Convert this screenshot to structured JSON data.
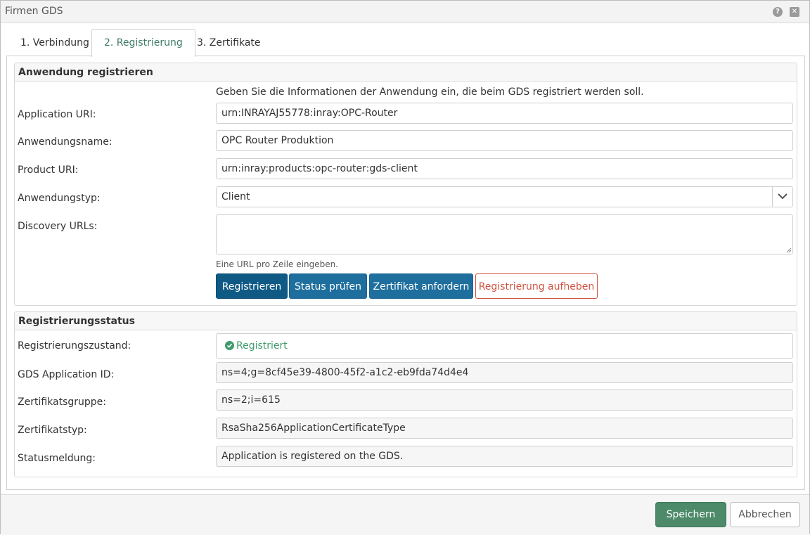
{
  "window": {
    "title": "Firmen GDS",
    "help_glyph": "?",
    "close_glyph": "✕"
  },
  "tabs": [
    {
      "label": "1. Verbindung"
    },
    {
      "label": "2. Registrierung",
      "active": true
    },
    {
      "label": "3. Zertifikate"
    }
  ],
  "registration": {
    "legend": "Anwendung registrieren",
    "intro": "Geben Sie die Informationen der Anwendung ein, die beim GDS registriert werden soll.",
    "application_uri": {
      "label": "Application URI:",
      "value": "urn:INRAYAJ55778:inray:OPC-Router"
    },
    "application_name": {
      "label": "Anwendungsname:",
      "value": "OPC Router Produktion"
    },
    "product_uri": {
      "label": "Product URI:",
      "value": "urn:inray:products:opc-router:gds-client"
    },
    "application_type": {
      "label": "Anwendungstyp:",
      "value": "Client"
    },
    "discovery_urls": {
      "label": "Discovery URLs:",
      "value": "",
      "hint": "Eine URL pro Zeile eingeben."
    },
    "buttons": {
      "register": "Registrieren",
      "check_status": "Status prüfen",
      "request_cert": "Zertifikat anfordern",
      "unregister": "Registrierung aufheben"
    }
  },
  "status": {
    "legend": "Registrierungsstatus",
    "state": {
      "label": "Registrierungszustand:",
      "value": "Registriert"
    },
    "gds_app_id": {
      "label": "GDS Application ID:",
      "value": "ns=4;g=8cf45e39-4800-45f2-a1c2-eb9fda74d4e4"
    },
    "cert_group": {
      "label": "Zertifikatsgruppe:",
      "value": "ns=2;i=615"
    },
    "cert_type": {
      "label": "Zertifikatstyp:",
      "value": "RsaSha256ApplicationCertificateType"
    },
    "message": {
      "label": "Statusmeldung:",
      "value": "Application is registered on the GDS."
    }
  },
  "footer": {
    "save": "Speichern",
    "cancel": "Abbrechen"
  },
  "colors": {
    "primary": "#0f5a85",
    "button": "#1f6f9e",
    "danger": "#cf5340",
    "success": "#3f9a6c",
    "save": "#4c8a69"
  }
}
